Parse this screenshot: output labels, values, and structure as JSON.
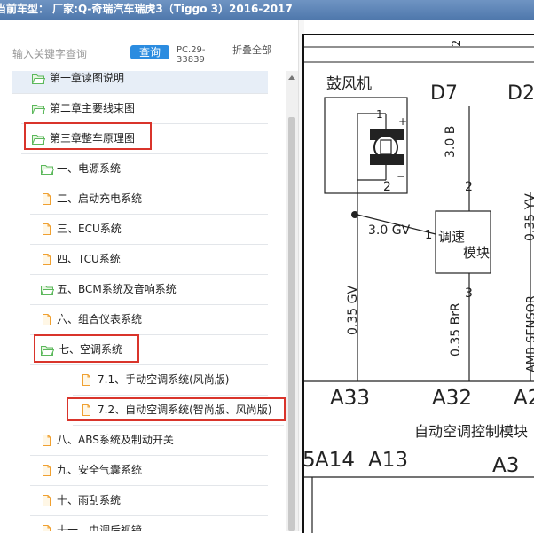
{
  "window": {
    "title": "当前车型：   厂家:Q-奇瑞汽车瑞虎3（Tiggo 3）2016-2017"
  },
  "toolbar": {
    "search_placeholder": "输入关键字查询",
    "query_label": "查询",
    "pc_code": "PC.29-33839",
    "collapse_label": "折叠全部"
  },
  "tree": {
    "items": [
      {
        "label": "第一章读图说明",
        "icon": "folder-open-icon"
      },
      {
        "label": "第二章主要线束图",
        "icon": "folder-open-icon"
      },
      {
        "label": "第三章整车原理图",
        "icon": "folder-open-icon"
      },
      {
        "label": "一、电源系统",
        "icon": "folder-open-icon"
      },
      {
        "label": "二、启动充电系统",
        "icon": "document-icon"
      },
      {
        "label": "三、ECU系统",
        "icon": "document-icon"
      },
      {
        "label": "四、TCU系统",
        "icon": "document-icon"
      },
      {
        "label": "五、BCM系统及音响系统",
        "icon": "folder-open-icon"
      },
      {
        "label": "六、组合仪表系统",
        "icon": "document-icon"
      },
      {
        "label": "七、空调系统",
        "icon": "folder-open-icon"
      },
      {
        "label": "7.1、手动空调系统(风尚版)",
        "icon": "document-icon"
      },
      {
        "label": "7.2、自动空调系统(智尚版、风尚版)",
        "icon": "document-icon"
      },
      {
        "label": "八、ABS系统及制动开关",
        "icon": "document-icon"
      },
      {
        "label": "九、安全气囊系统",
        "icon": "document-icon"
      },
      {
        "label": "十、雨刮系统",
        "icon": "document-icon"
      },
      {
        "label": "十一、电调后视镜",
        "icon": "document-icon"
      }
    ]
  },
  "colors": {
    "folder": "#5cb85c",
    "document": "#f0a030",
    "highlight": "#d9342b",
    "accent": "#2b8ce0"
  },
  "diagram": {
    "connector_top": "2",
    "blower_label": "鼓风机",
    "pin_1": "1",
    "pin_2": "2",
    "plus": "+",
    "minus": "−",
    "conn_d7": "D7",
    "conn_d2": "D2",
    "wire_30b": "3.0 B",
    "node_2": "2",
    "wire_30gv": "3.0 GV",
    "node_1": "1",
    "speed_module_line1": "调速",
    "speed_module_line2": "模块",
    "wire_035yv": "0.35 YV",
    "node_3": "3",
    "wire_035gv": "0.35 GV",
    "wire_035brr": "0.35 BrR",
    "wire_amb": "AMB SENSOR",
    "conn_a33": "A33",
    "conn_a32": "A32",
    "conn_a2": "A2",
    "module_label": "自动空调控制模块",
    "conn_a14": "A14",
    "conn_a14_prefix": "5",
    "conn_a13": "A13",
    "conn_a3": "A3"
  }
}
